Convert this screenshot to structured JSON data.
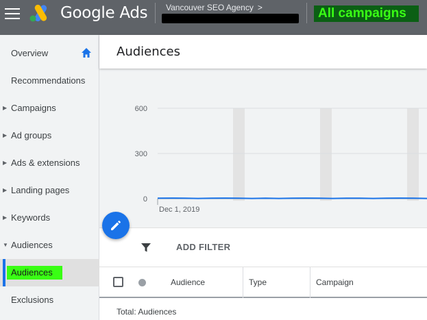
{
  "header": {
    "brand": "Google Ads",
    "account_name": "Vancouver SEO Agency",
    "account_chevron": ">",
    "campaign_scope": "All campaigns"
  },
  "sidebar": {
    "items": [
      {
        "label": "Overview",
        "icon": "home-icon"
      },
      {
        "label": "Recommendations"
      },
      {
        "label": "Campaigns",
        "expandable": true
      },
      {
        "label": "Ad groups",
        "expandable": true
      },
      {
        "label": "Ads & extensions",
        "expandable": true
      },
      {
        "label": "Landing pages",
        "expandable": true
      },
      {
        "label": "Keywords",
        "expandable": true
      },
      {
        "label": "Audiences",
        "expandable": true,
        "expanded": true
      },
      {
        "label": "Audiences",
        "selected": true
      },
      {
        "label": "Exclusions"
      }
    ]
  },
  "main": {
    "title": "Audiences",
    "chart": {
      "y_ticks": [
        "600",
        "300",
        "0"
      ],
      "x_start_label": "Dec 1, 2019"
    },
    "filter": {
      "add_label": "ADD FILTER"
    },
    "table": {
      "columns": [
        "Audience",
        "Type",
        "Campaign"
      ],
      "total_label": "Total: Audiences"
    }
  },
  "colors": {
    "topbar": "#5f6368",
    "accent": "#1a73e8",
    "highlight": "#39ff14",
    "campaign_bg": "#0b5f14"
  },
  "chart_data": {
    "type": "line",
    "ylim": [
      0,
      600
    ],
    "y_ticks": [
      0,
      300,
      600
    ],
    "x_start": "Dec 1, 2019",
    "values": [
      3,
      4,
      3,
      2,
      3,
      4,
      3,
      2,
      3,
      2,
      3,
      4,
      3,
      2,
      3,
      3,
      2,
      3,
      4,
      3,
      2
    ]
  }
}
